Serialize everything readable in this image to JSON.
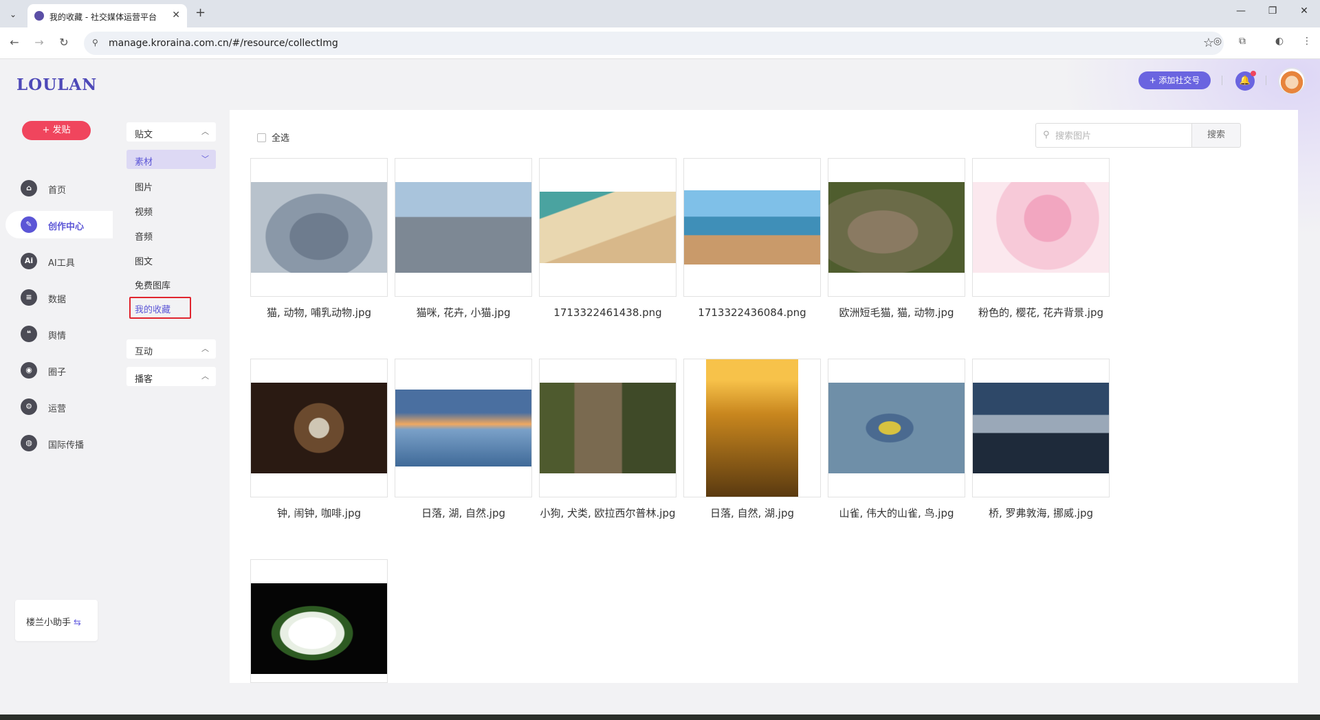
{
  "browser": {
    "tab_title": "我的收藏 - 社交媒体运营平台",
    "url": "manage.kroraina.com.cn/#/resource/collectImg"
  },
  "app": {
    "logo": "LOULAN",
    "post_button": "+ 发贴",
    "add_account": "+ 添加社交号",
    "helper": "楼兰小助手"
  },
  "nav": [
    {
      "label": "首页",
      "icon": "home-icon",
      "glyph": "⌂",
      "active": false
    },
    {
      "label": "创作中心",
      "icon": "palette-icon",
      "glyph": "✎",
      "active": true
    },
    {
      "label": "AI工具",
      "icon": "ai-icon",
      "glyph": "Ai",
      "active": false
    },
    {
      "label": "数据",
      "icon": "database-icon",
      "glyph": "≡",
      "active": false
    },
    {
      "label": "舆情",
      "icon": "quote-icon",
      "glyph": "❝",
      "active": false
    },
    {
      "label": "圈子",
      "icon": "compass-icon",
      "glyph": "◉",
      "active": false
    },
    {
      "label": "运营",
      "icon": "gear-icon",
      "glyph": "⚙",
      "active": false
    },
    {
      "label": "国际传播",
      "icon": "globe-icon",
      "glyph": "◍",
      "active": false
    }
  ],
  "subnav": {
    "groups": [
      {
        "label": "贴文",
        "expanded": false
      },
      {
        "label": "素材",
        "expanded": true
      },
      {
        "label": "互动",
        "expanded": false
      },
      {
        "label": "播客",
        "expanded": false
      }
    ],
    "items": [
      "图片",
      "视频",
      "音频",
      "图文",
      "免费图库",
      "我的收藏"
    ],
    "active_item": "我的收藏"
  },
  "content": {
    "select_all": "全选",
    "search_placeholder": "搜索图片",
    "search_button": "搜索",
    "files": [
      {
        "name": "猫, 动物, 哺乳动物.jpg",
        "theme": "blue-cat"
      },
      {
        "name": "猫咪, 花卉, 小猫.jpg",
        "theme": "kitten-flower"
      },
      {
        "name": "1713322461438.png",
        "theme": "beach-kids"
      },
      {
        "name": "1713322436084.png",
        "theme": "beach-play"
      },
      {
        "name": "欧洲短毛猫, 猫, 动物.jpg",
        "theme": "tabby-cat"
      },
      {
        "name": "粉色的, 樱花, 花卉背景.jpg",
        "theme": "cherry-blossom"
      },
      {
        "name": "钟, 闹钟, 咖啡.jpg",
        "theme": "alarm-clock"
      },
      {
        "name": "日落, 湖, 自然.jpg",
        "theme": "sunset-lake"
      },
      {
        "name": "小狗, 犬类, 欧拉西尔普林.jpg",
        "theme": "puppy-tree"
      },
      {
        "name": "日落, 自然, 湖.jpg",
        "theme": "golden-water"
      },
      {
        "name": "山雀, 伟大的山雀, 鸟.jpg",
        "theme": "tit-bird"
      },
      {
        "name": "桥, 罗弗敦海, 挪威.jpg",
        "theme": "bridge-norway"
      },
      {
        "name": "",
        "theme": "white-tulip"
      }
    ]
  }
}
